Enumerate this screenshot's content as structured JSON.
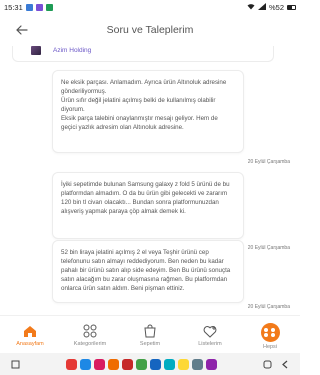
{
  "status_bar": {
    "time": "15:31",
    "battery_level": "%52"
  },
  "header": {
    "title": "Soru ve Taleplerim",
    "back_icon": "arrow-left-icon"
  },
  "shop": {
    "name": "Azim Holding"
  },
  "messages": [
    {
      "text": "Ne eksik parçası. Anlamadım. Ayrıca ürün Altınoluk adresine gönderiliyormuş.\nÜrün sıfır değil jelatini açılmış belki de kullanılmış olabilir diyorum.\nEksik parça talebini onaylanmıştır mesajı geliyor. Hem de geçici yazlık adresim olan Altınoluk adresine.",
      "time": "20 Eylül Çarşamba"
    },
    {
      "text": "İyiki sepetimde bulunan Samsung galaxy z fold 5 ürünü de bu platformdan almadım. O da bu ürün gibi gelecekti ve zararım 120 bin tl civarı olacaktı... Bundan sonra platformunuzdan alışveriş yapmak paraya çöp almak demek ki.",
      "time": "20 Eylül Çarşamba"
    },
    {
      "text": "52 bin liraya jelatini açılmış 2 el veya Teşhir ürünü cep telefonunu satın almayı reddediyorum. Ben neden bu kadar pahalı bir ürünü satın alıp side edeyim. Ben Bu ürünü sonuçta satın alacağım bu zarar oluşmasına rağmen. Bu platformdan onlarca ürün satın aldım. Beni pişman ettiniz.",
      "time": "20 Eylül Çarşamba"
    }
  ],
  "nav": {
    "items": [
      {
        "label": "Anasayfam",
        "icon": "home-icon",
        "active": true
      },
      {
        "label": "Kategorilerim",
        "icon": "categories-icon"
      },
      {
        "label": "Sepetim",
        "icon": "cart-icon"
      },
      {
        "label": "Listelerim",
        "icon": "heart-list-icon"
      },
      {
        "label": "Hepsi",
        "icon": "all-grid-icon"
      }
    ]
  },
  "colors": {
    "accent": "#f27a1a",
    "shop_link": "#6b57c7"
  }
}
